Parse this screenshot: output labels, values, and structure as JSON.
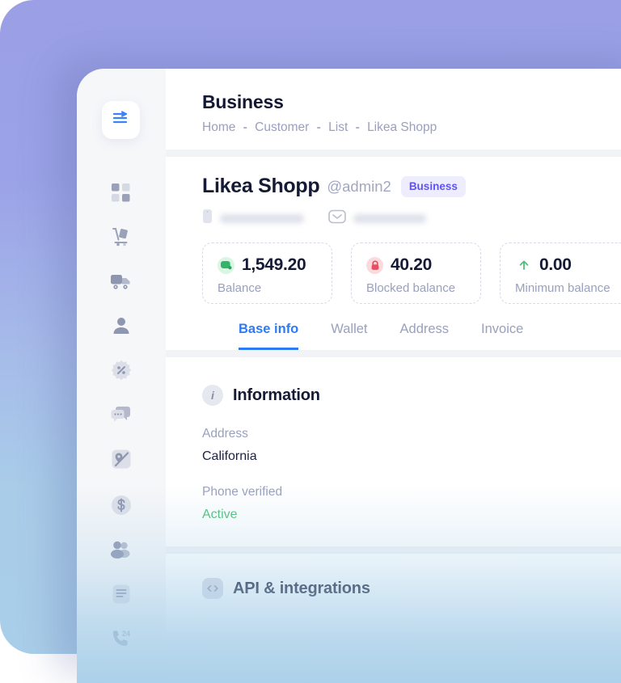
{
  "app": {
    "sidebar": {
      "logo_icon": "collapse-arrow-icon",
      "items": [
        {
          "name": "dashboard",
          "icon": "grid-squares-icon"
        },
        {
          "name": "orders",
          "icon": "hand-truck-icon"
        },
        {
          "name": "delivery",
          "icon": "truck-icon"
        },
        {
          "name": "profile",
          "icon": "person-icon"
        },
        {
          "name": "discounts",
          "icon": "percent-badge-icon"
        },
        {
          "name": "messages",
          "icon": "chat-bubbles-icon"
        },
        {
          "name": "map",
          "icon": "map-pin-icon"
        },
        {
          "name": "finance",
          "icon": "dollar-coin-icon"
        },
        {
          "name": "customers",
          "icon": "users-group-icon"
        },
        {
          "name": "documents",
          "icon": "document-icon"
        },
        {
          "name": "support",
          "icon": "phone-24h-icon"
        }
      ]
    },
    "header": {
      "title": "Business",
      "breadcrumb": [
        "Home",
        "Customer",
        "List",
        "Likea Shopp"
      ],
      "separator": "-"
    },
    "profile": {
      "name": "Likea Shopp",
      "handle": "@admin2",
      "badge": "Business",
      "badge_color": "#5f53f5",
      "badge_bg": "#eeedfe",
      "phone_redacted": true,
      "email_redacted": true,
      "phone_icon": "phone-icon",
      "email_icon": "envelope-icon"
    },
    "balances": [
      {
        "value": "1,549.20",
        "label": "Balance",
        "icon": "money-icon",
        "icon_color": "#34b46a",
        "icon_bg": "#d9f6e3"
      },
      {
        "value": "40.20",
        "label": "Blocked balance",
        "icon": "lock-icon",
        "icon_color": "#e8505f",
        "icon_bg": "#fcd9dd"
      },
      {
        "value": "0.00",
        "label": "Minimum balance",
        "icon": "arrow-up-icon",
        "icon_color": "#51c07a",
        "icon_bg": "transparent"
      }
    ],
    "tabs": [
      {
        "label": "Base info",
        "active": true
      },
      {
        "label": "Wallet",
        "active": false
      },
      {
        "label": "Address",
        "active": false
      },
      {
        "label": "Invoice",
        "active": false
      }
    ],
    "tab_accent": "#2d7bf4",
    "information": {
      "icon": "info-icon",
      "title": "Information",
      "fields": [
        {
          "label": "Address",
          "value": "California",
          "status": false
        },
        {
          "label": "Phone verified",
          "value": "Active",
          "status": true
        }
      ],
      "status_color": "#51c07a"
    },
    "api_section": {
      "icon": "code-icon",
      "title": "API & integrations"
    },
    "theme": {
      "backdrop_top": "#9ba0e6",
      "backdrop_bottom": "#a9cfe9",
      "panel_bg": "#ffffff",
      "sidebar_bg": "#f6f7f9",
      "muted_text": "#9aa0bd",
      "dark_text": "#151a35"
    }
  }
}
